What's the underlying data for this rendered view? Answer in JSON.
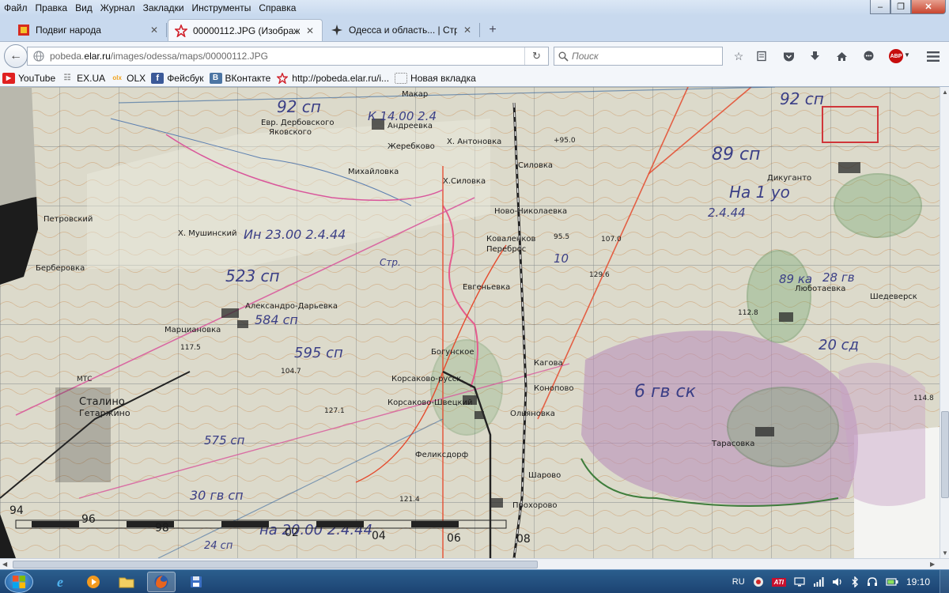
{
  "menubar": {
    "items": [
      "Файл",
      "Правка",
      "Вид",
      "Журнал",
      "Закладки",
      "Инструменты",
      "Справка"
    ]
  },
  "tabs": [
    {
      "label": "Подвиг народа",
      "icon": "podvig-naroda-favicon"
    },
    {
      "label": "00000112.JPG (Изображен...",
      "icon": "red-star-favicon"
    },
    {
      "label": "Одесса и область... | Стра...",
      "icon": "compass-favicon"
    }
  ],
  "navbar": {
    "url_prefix": "pobeda.",
    "url_host": "elar.ru",
    "url_path": "/images/odessa/maps/00000112.JPG",
    "search_placeholder": "Поиск",
    "abp_label": "ABP"
  },
  "bookmarks": [
    {
      "label": "YouTube",
      "icon": "youtube-icon",
      "color": "#e02020"
    },
    {
      "label": "EX.UA",
      "icon": "exua-icon",
      "color": "#8a8a8a"
    },
    {
      "label": "OLX",
      "icon": "olx-icon",
      "color": "#f0a21b"
    },
    {
      "label": "Фейсбук",
      "icon": "facebook-icon",
      "color": "#3b5998"
    },
    {
      "label": "ВКонтакте",
      "icon": "vk-icon",
      "color": "#4c75a3"
    },
    {
      "label": "http://pobeda.elar.ru/i...",
      "icon": "red-star-icon",
      "color": "#d01f1f"
    },
    {
      "label": "Новая вкладка",
      "icon": "blank-page-icon",
      "color": "#ffffff"
    }
  ],
  "map": {
    "places": [
      "Макар",
      "Андреевка",
      "Яковского",
      "Жеребково",
      "Х. Антоновка",
      "Силовка",
      "Х.Силовка",
      "Михайловка",
      "Ново-Николаевка",
      "Петровский",
      "Х. Мушинский",
      "Берберовка",
      "Коваленков",
      "Переброс",
      "Александро-Дарьевка",
      "Марциановка",
      "Евгеньевка",
      "Богунское",
      "Корсаково-русск.",
      "Корсаково-Швецкий",
      "Кагова",
      "Конопово",
      "Ольяновка",
      "Сталино",
      "Гетаржино",
      "Феликсдорф",
      "Шарово",
      "Прохорово",
      "Дикуганто",
      "Люботаевка",
      "Шедеверск",
      "Тарасовка",
      "Евр. Дербовского"
    ],
    "annotations": [
      "92 сп",
      "К 14.00 2.4",
      "89 сп",
      "На 1 уо",
      "2.4.44",
      "Ин 23.00 2.4.44",
      "523 сп",
      "584 сп",
      "595 сп",
      "6 гв ск",
      "575 сп",
      "30 гв сп",
      "на 20.00 2.4.44",
      "24 сп",
      "89 ка",
      "20 сд",
      "92 сп",
      "28 гв",
      "10",
      "Стр.",
      "МТС"
    ],
    "grid_numbers": [
      "94",
      "96",
      "98",
      "02",
      "04",
      "06",
      "08"
    ],
    "elevations": [
      "+95.0",
      "95.5",
      "107.0",
      "129.6",
      "117.5",
      "104.7",
      "127.1",
      "121.4",
      "114.8",
      "112.8"
    ]
  },
  "taskbar": {
    "language": "RU",
    "clock": "19:10",
    "apps": [
      "windows-start",
      "internet-explorer",
      "media-player",
      "file-explorer",
      "firefox",
      "save-app"
    ]
  },
  "colors": {
    "titlebar": "#c8d9ee",
    "taskbar": "#1c4372",
    "map_paper": "#dcdacb",
    "red_line": "#e54b2e",
    "pink_line": "#d9569b",
    "purple_area": "#b78ab9",
    "green_area": "#6fa66b"
  }
}
